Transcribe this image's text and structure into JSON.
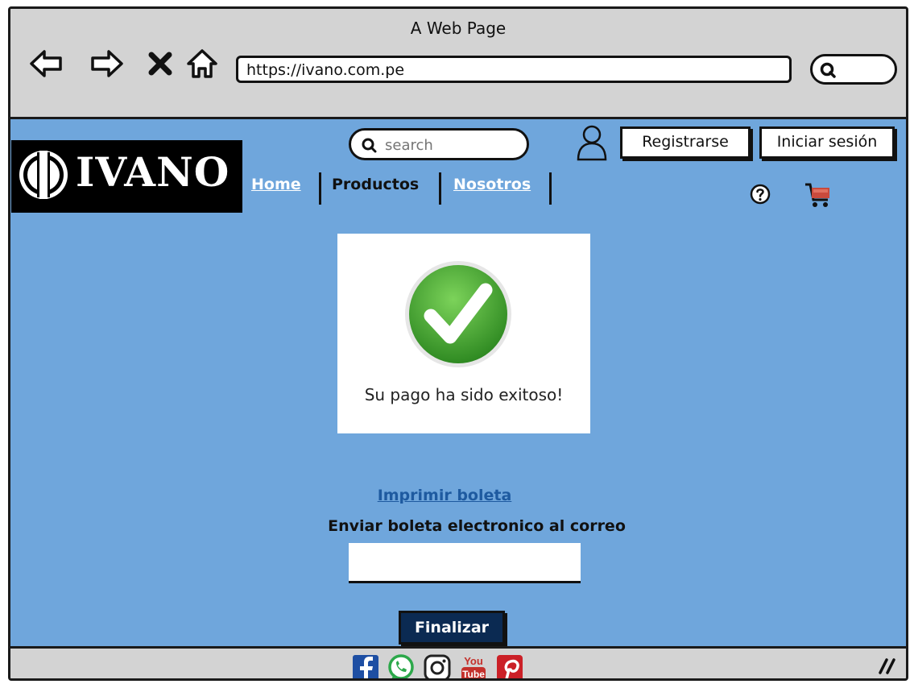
{
  "window": {
    "title": "A Web Page"
  },
  "browser": {
    "url": "https://ivano.com.pe",
    "icons": [
      "back-arrow-icon",
      "forward-arrow-icon",
      "close-icon",
      "home-icon",
      "search-icon"
    ]
  },
  "header": {
    "logo_text": "IVANO",
    "search_placeholder": "search",
    "register_label": "Registrarse",
    "login_label": "Iniciar sesión",
    "nav": [
      {
        "label": "Home"
      },
      {
        "label": "Productos"
      },
      {
        "label": "Nosotros"
      }
    ]
  },
  "main": {
    "success_message": "Su pago ha sido exitoso!",
    "print_link": "Imprimir boleta",
    "email_label": "Enviar boleta electronico al correo",
    "email_value": "",
    "finalize_label": "Finalizar"
  },
  "footer": {
    "social": [
      "facebook-icon",
      "whatsapp-icon",
      "instagram-icon",
      "youtube-icon",
      "pinterest-icon"
    ],
    "youtube_text_top": "You",
    "youtube_text_bottom": "Tube"
  },
  "colors": {
    "content_bg": "#6fa6dc",
    "finalize_bg": "#0b2a52",
    "link": "#1e5aa0",
    "success_green": "#3d9a2e"
  }
}
